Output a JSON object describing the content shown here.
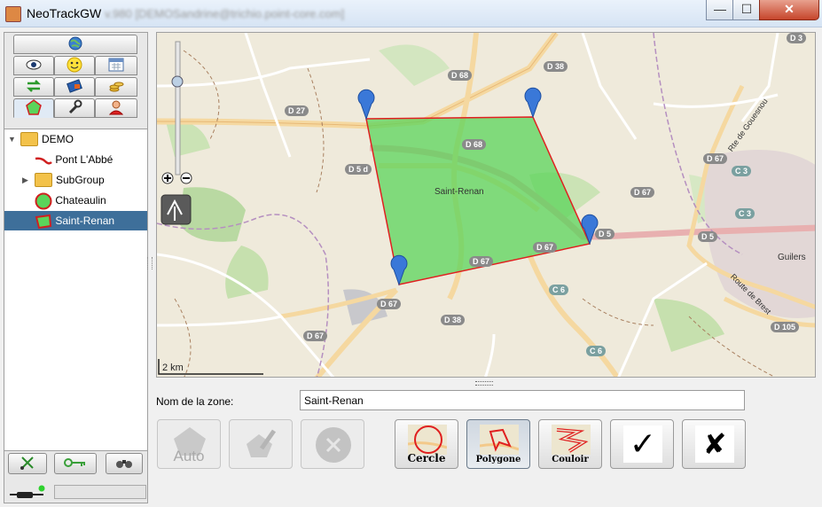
{
  "window": {
    "title": "NeoTrackGW",
    "subtitle": "v.980 [DEMOSandrine@trichio.point-core.com]",
    "minimize_glyph": "—",
    "maximize_glyph": "☐",
    "close_glyph": "✕"
  },
  "tabs": [
    {
      "name": "globe-icon"
    },
    {
      "name": "eye-icon"
    },
    {
      "name": "smiley-icon"
    },
    {
      "name": "calendar-icon"
    },
    {
      "name": "arrows-icon"
    },
    {
      "name": "card-icon"
    },
    {
      "name": "coins-icon"
    },
    {
      "name": "zone-icon"
    },
    {
      "name": "wrench-icon"
    },
    {
      "name": "user-icon"
    }
  ],
  "tree": {
    "root": "DEMO",
    "items": [
      {
        "label": "Pont L'Abbé",
        "type": "route"
      },
      {
        "label": "SubGroup",
        "type": "folder"
      },
      {
        "label": "Chateaulin",
        "type": "circle"
      },
      {
        "label": "Saint-Renan",
        "type": "polygon",
        "selected": true
      }
    ]
  },
  "map": {
    "place_labels": [
      "Saint-Renan",
      "Guilers",
      "Route de Brest",
      "Rte de Gouesnou"
    ],
    "road_labels": [
      "D 68",
      "D 68",
      "D 38",
      "D 27",
      "D 5 d",
      "D 67",
      "D 67",
      "D 67",
      "D 67",
      "D 5",
      "D 5",
      "C 6",
      "D 38",
      "D 67",
      "C 6",
      "D 105",
      "D 3",
      "D 67",
      "C 3",
      "C 3"
    ],
    "scale": "2 km"
  },
  "form": {
    "zone_label": "Nom de la zone:",
    "zone_value": "Saint-Renan"
  },
  "tools": {
    "auto_label": "Auto",
    "circle_label": "Cercle",
    "polygon_label": "Polygone",
    "corridor_label": "Couloir",
    "ok_glyph": "✓",
    "cancel_glyph": "✘"
  },
  "colors": {
    "zone_fill": "#5bd45b",
    "zone_stroke": "#e02020",
    "selection": "#3e6f9a",
    "marker": "#3a78d8"
  }
}
